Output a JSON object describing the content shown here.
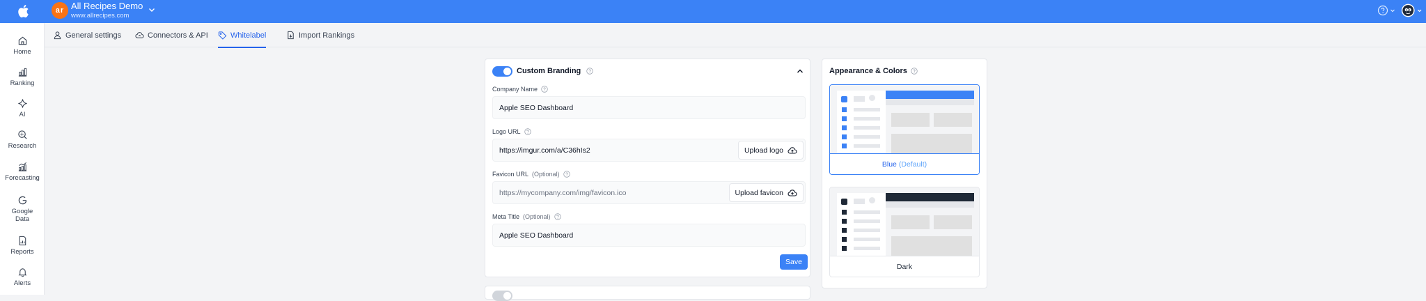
{
  "header": {
    "project_initials": "ar",
    "project_name": "All Recipes Demo",
    "project_url": "www.allrecipes.com",
    "brand_color": "#3b82f6",
    "logo_icon": "apple-icon"
  },
  "sidebar": {
    "items": [
      {
        "label": "Home",
        "icon": "home-icon"
      },
      {
        "label": "Ranking",
        "icon": "bar-chart-icon"
      },
      {
        "label": "AI",
        "icon": "sparkle-icon"
      },
      {
        "label": "Research",
        "icon": "search-icon"
      },
      {
        "label": "Forecasting",
        "icon": "forecast-chart-icon"
      },
      {
        "label": "Google Data",
        "icon": "google-icon"
      },
      {
        "label": "Reports",
        "icon": "report-icon"
      },
      {
        "label": "Alerts",
        "icon": "bell-icon"
      }
    ]
  },
  "tabs": [
    {
      "label": "General settings",
      "icon": "user-icon",
      "active": false
    },
    {
      "label": "Connectors & API",
      "icon": "cloud-icon",
      "active": false
    },
    {
      "label": "Whitelabel",
      "icon": "tag-icon",
      "active": true
    },
    {
      "label": "Import Rankings",
      "icon": "file-import-icon",
      "active": false
    }
  ],
  "branding": {
    "title": "Custom Branding",
    "enabled": true,
    "company_name": {
      "label": "Company Name",
      "value": "Apple SEO Dashboard"
    },
    "logo_url": {
      "label": "Logo URL",
      "value": "https://imgur.com/a/C36hIs2",
      "button": "Upload logo"
    },
    "favicon_url": {
      "label": "Favicon URL",
      "optional": "(Optional)",
      "placeholder": "https://mycompany.com/img/favicon.ico",
      "button": "Upload favicon"
    },
    "meta_title": {
      "label": "Meta Title",
      "optional": "(Optional)",
      "value": "Apple SEO Dashboard"
    },
    "save_label": "Save"
  },
  "appearance": {
    "title": "Appearance & Colors",
    "themes": [
      {
        "name": "Blue",
        "suffix": "(Default)",
        "selected": true,
        "accent": "#3b82f6"
      },
      {
        "name": "Dark",
        "suffix": "",
        "selected": false,
        "accent": "#1f2937"
      }
    ]
  }
}
